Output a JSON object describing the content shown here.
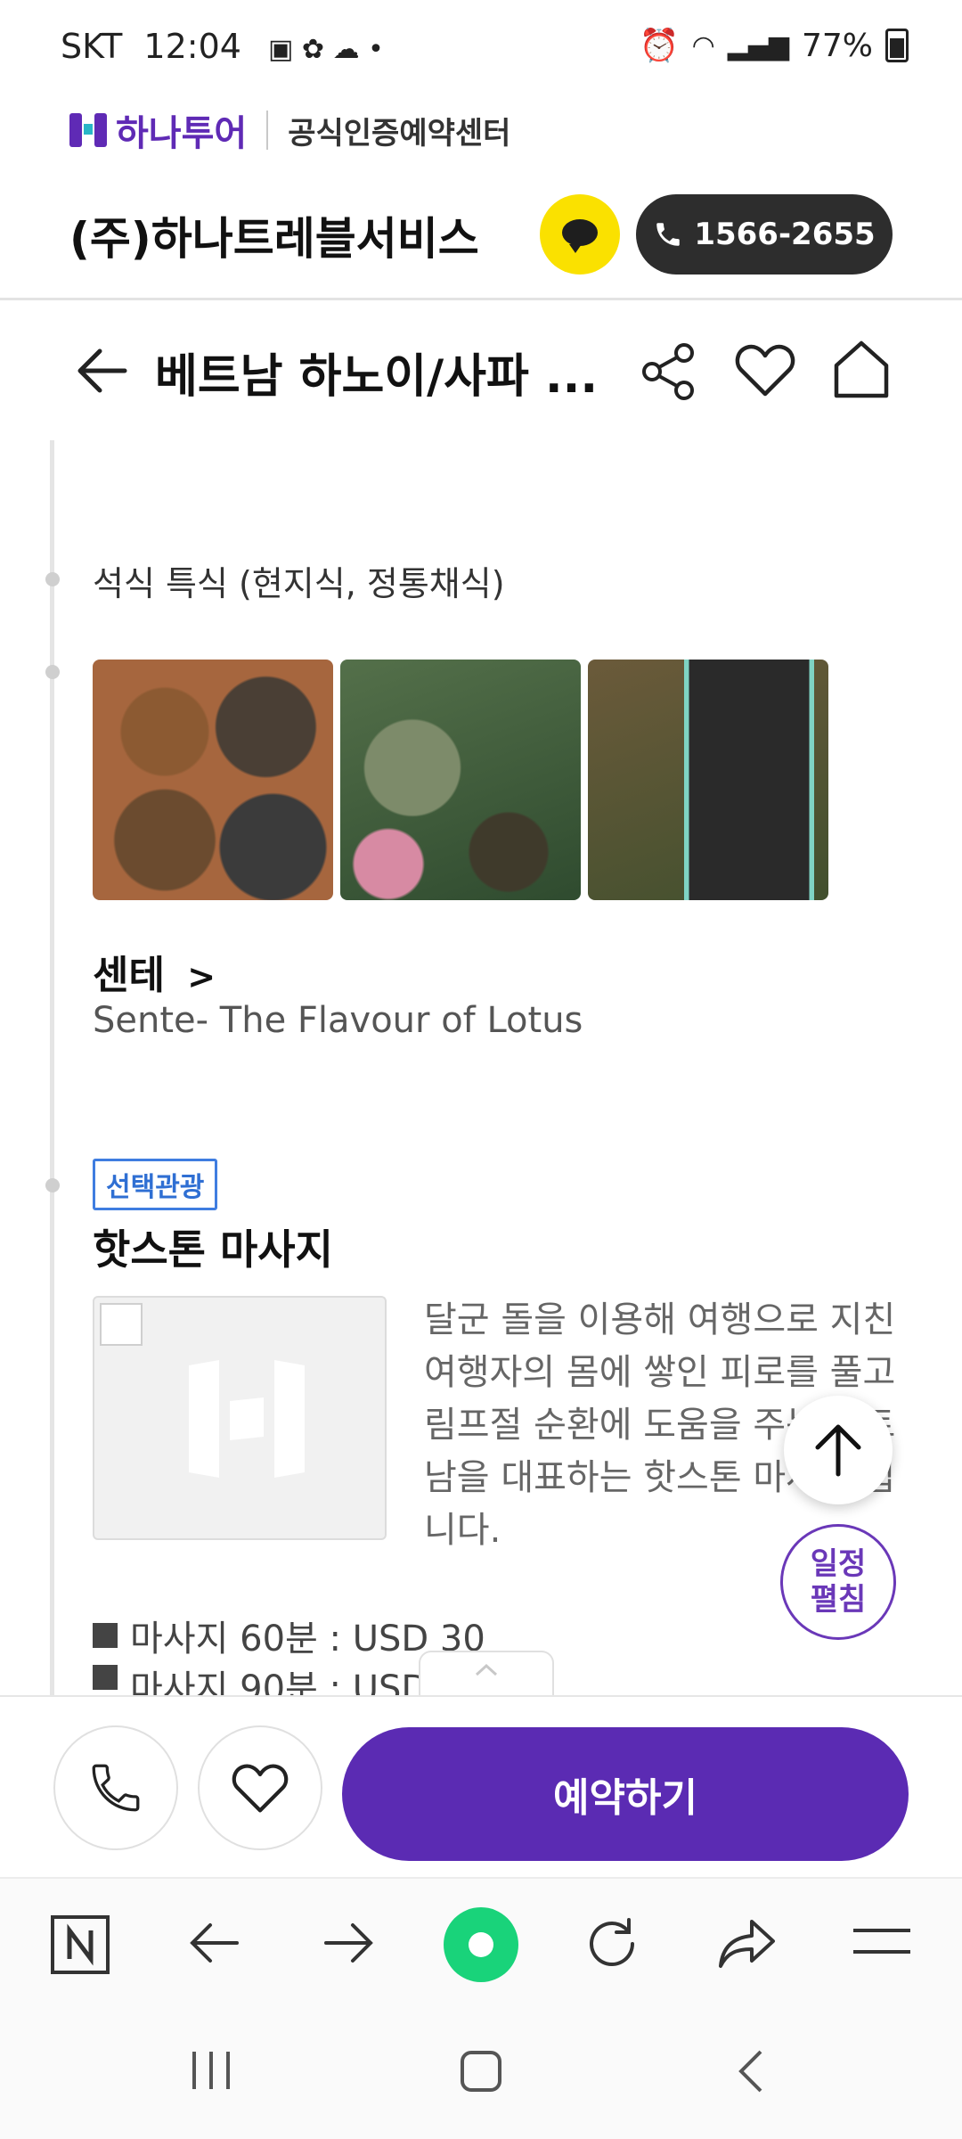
{
  "status_bar": {
    "carrier": "SKT",
    "time": "12:04",
    "battery": "77%"
  },
  "brand": {
    "name": "하나투어",
    "subtitle": "공식인증예약센터"
  },
  "company": {
    "name": "(주)하나트레블서비스",
    "phone": "1566-2655"
  },
  "header": {
    "title": "베트남 하노이/사파 ..."
  },
  "itinerary": {
    "meal": "석식 특식 (현지식, 정통채식)",
    "restaurant": {
      "name": "센테",
      "chevron": ">",
      "subtitle": "Sente- The Flavour of Lotus"
    },
    "activity": {
      "badge": "선택관광",
      "title": "핫스톤 마사지",
      "description": "달군 돌을 이용해 여행으로 지친 여행자의 몸에 쌓인 피로를 풀고 림프절 순환에 도움을 주는 베트남을 대표하는 핫스톤 마사지 입니다.",
      "prices": [
        "마사지 60분 : USD 30",
        "마사지 90분 : USD"
      ]
    }
  },
  "floating": {
    "schedule_line1": "일정",
    "schedule_line2": "펼침"
  },
  "action_bar": {
    "reserve_label": "예약하기"
  },
  "colors": {
    "brand_purple": "#5b2bb3",
    "kakao_yellow": "#fae100",
    "badge_blue": "#2f6fd3",
    "green": "#19d37a"
  }
}
